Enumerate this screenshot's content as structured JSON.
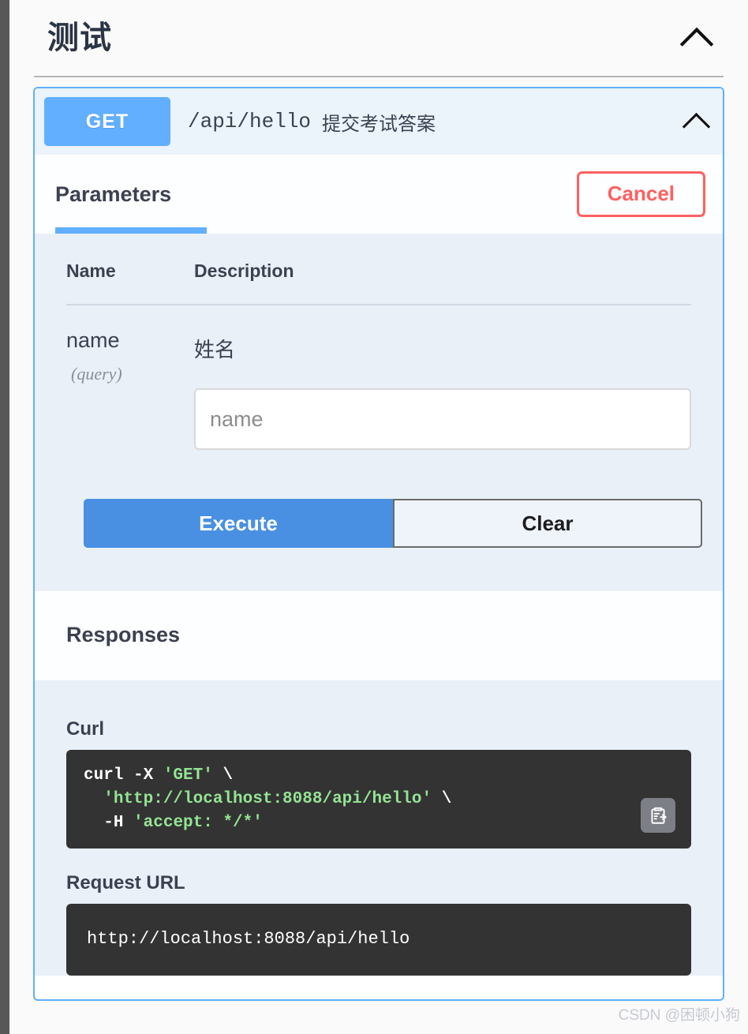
{
  "colors": {
    "method_get": "#61affe",
    "accent_blue": "#4990e2",
    "cancel_red": "#ff6060",
    "panel_blue": "#e9f0f8",
    "code_bg": "#333333",
    "code_string": "#94e494"
  },
  "tag": {
    "title": "测试",
    "collapse_icon": "chevron-up-icon"
  },
  "operation": {
    "method": "GET",
    "path": "/api/hello",
    "summary": "提交考试答案",
    "collapse_icon": "chevron-up-icon"
  },
  "parameters_section": {
    "tab_label": "Parameters",
    "cancel_label": "Cancel",
    "columns": [
      "Name",
      "Description"
    ],
    "rows": [
      {
        "name": "name",
        "in": "(query)",
        "description": "姓名",
        "input_value": "",
        "input_placeholder": "name"
      }
    ]
  },
  "actions": {
    "execute_label": "Execute",
    "clear_label": "Clear"
  },
  "responses_section": {
    "title": "Responses",
    "curl_label": "Curl",
    "curl": {
      "line1_cmd": "curl -X ",
      "line1_str": "'GET'",
      "line1_tail": " \\",
      "line2_str": "'http://localhost:8088/api/hello'",
      "line2_tail": " \\",
      "line3_cmd": "-H ",
      "line3_str": "'accept: */*'"
    },
    "copy_icon": "clipboard-copy-icon",
    "request_url_label": "Request URL",
    "request_url": "http://localhost:8088/api/hello"
  },
  "watermark": "CSDN @困顿小狗"
}
